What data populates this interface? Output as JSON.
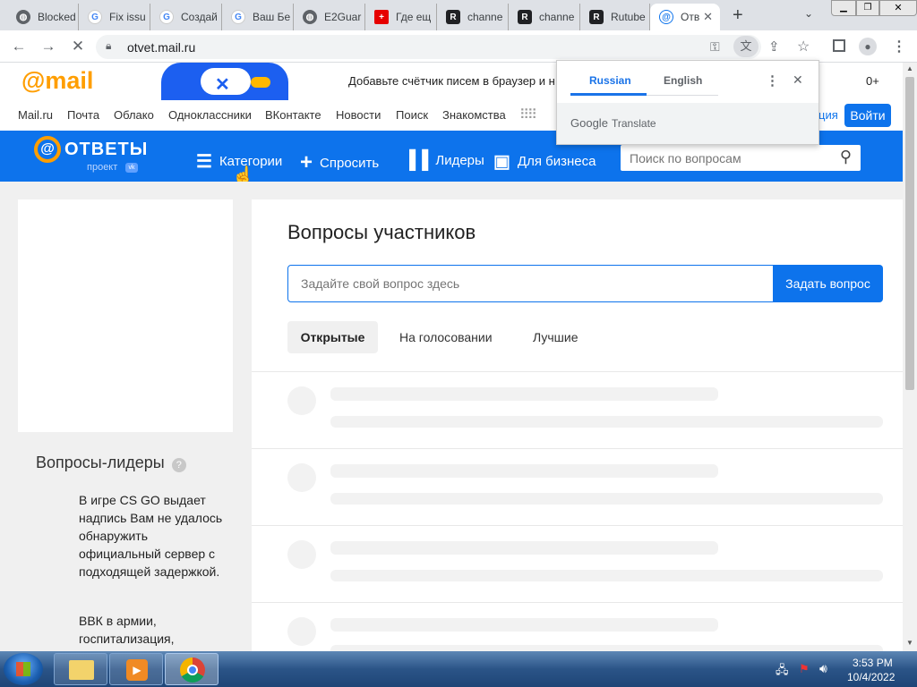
{
  "browser": {
    "tabs": [
      {
        "label": "Blocked",
        "icon": "globe-icon"
      },
      {
        "label": "Fix issu",
        "icon": "google-icon"
      },
      {
        "label": "Создай",
        "icon": "google-icon"
      },
      {
        "label": "Ваш Бе",
        "icon": "google-icon"
      },
      {
        "label": "E2Guar",
        "icon": "globe-icon"
      },
      {
        "label": "Где ещ",
        "icon": "swiss-flag-icon"
      },
      {
        "label": "channe",
        "icon": "rutube-icon"
      },
      {
        "label": "channe",
        "icon": "rutube-icon"
      },
      {
        "label": "Rutube",
        "icon": "rutube-icon"
      },
      {
        "label": "Отв",
        "icon": "otvety-icon"
      }
    ],
    "url": "otvet.mail.ru"
  },
  "mailbar": {
    "logo": "@mail",
    "promo": "Добавьте счётчик писем в браузер и н",
    "age": "0+"
  },
  "portal": {
    "links": [
      "Mail.ru",
      "Почта",
      "Облако",
      "Одноклассники",
      "ВКонтакте",
      "Новости",
      "Поиск",
      "Знакомства"
    ],
    "register_partial": "ция",
    "login": "Войти"
  },
  "header": {
    "logo": "ОТВЕТЫ",
    "logo_sub": "проект",
    "nav": [
      "Категории",
      "Спросить",
      "Лидеры",
      "Для бизнеса"
    ],
    "search_placeholder": "Поиск по вопросам"
  },
  "main": {
    "title": "Вопросы участников",
    "ask_placeholder": "Задайте свой вопрос здесь",
    "ask_button": "Задать вопрос",
    "tabs": [
      "Открытые",
      "На голосовании",
      "Лучшие"
    ]
  },
  "leaders": {
    "title": "Вопросы-лидеры",
    "items": [
      "В игре CS GO выдает надпись Вам не удалось обнаружить официальный сервер с подходящей задержкой.",
      "ВВК в армии, госпитализация,"
    ]
  },
  "translate": {
    "lang_from": "Russian",
    "lang_to": "English",
    "brand": "Google",
    "product": "Translate"
  },
  "taskbar": {
    "time": "3:53 PM",
    "date": "10/4/2022"
  },
  "colors": {
    "accent": "#0d73ec",
    "mail_orange": "#ff9e00"
  }
}
